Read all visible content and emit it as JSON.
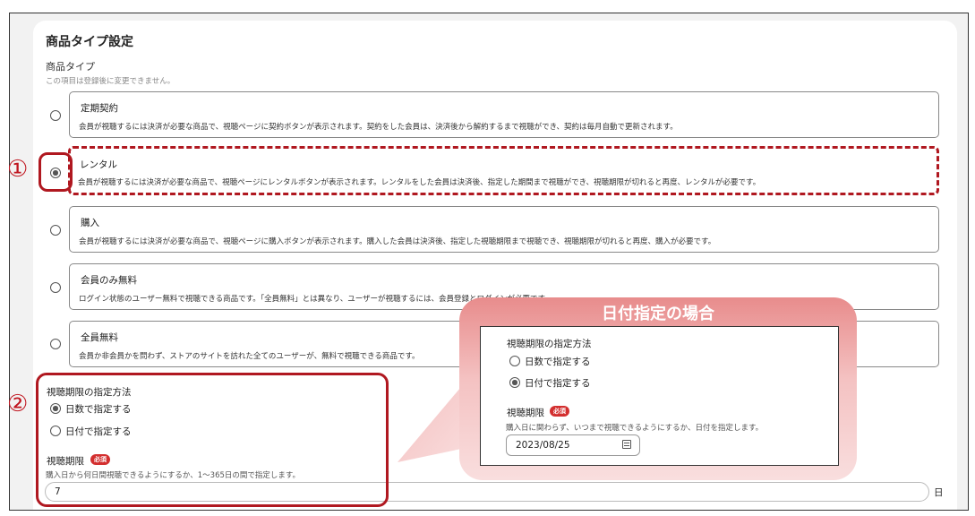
{
  "section": {
    "title": "商品タイプ設定",
    "field_label": "商品タイプ",
    "field_note": "この項目は登録後に変更できません。"
  },
  "options": [
    {
      "title": "定期契約",
      "desc": "会員が視聴するには決済が必要な商品で、視聴ページに契約ボタンが表示されます。契約をした会員は、決済後から解約するまで視聴ができ、契約は毎月自動で更新されます。",
      "selected": false
    },
    {
      "title": "レンタル",
      "desc": "会員が視聴するには決済が必要な商品で、視聴ページにレンタルボタンが表示されます。レンタルをした会員は決済後、指定した期間まで視聴ができ、視聴期限が切れると再度、レンタルが必要です。",
      "selected": true
    },
    {
      "title": "購入",
      "desc": "会員が視聴するには決済が必要な商品で、視聴ページに購入ボタンが表示されます。購入した会員は決済後、指定した視聴期限まで視聴でき、視聴期限が切れると再度、購入が必要です。",
      "selected": false
    },
    {
      "title": "会員のみ無料",
      "desc": "ログイン状態のユーザー無料で視聴できる商品です。「全員無料」とは異なり、ユーザーが視聴するには、会員登録とログインが必要です。",
      "selected": false
    },
    {
      "title": "全員無料",
      "desc": "会員か非会員かを問わず、ストアのサイトを訪れた全てのユーザーが、無料で視聴できる商品です。",
      "selected": false
    }
  ],
  "markers": {
    "one": "①",
    "two": "②"
  },
  "period": {
    "method_label": "視聴期限の指定方法",
    "by_days": "日数で指定する",
    "by_date": "日付で指定する",
    "limit_label": "視聴期限",
    "required": "必須",
    "days_note": "購入日から何日間視聴できるようにするか、1〜365日の間で指定します。",
    "days_value": "7",
    "days_unit": "日"
  },
  "callout": {
    "title": "日付指定の場合",
    "method_label": "視聴期限の指定方法",
    "by_days": "日数で指定する",
    "by_date": "日付で指定する",
    "limit_label": "視聴期限",
    "required": "必須",
    "date_note": "購入日に関わらず、いつまで視聴できるようにするか、日付を指定します。",
    "date_value": "2023/08/25"
  },
  "colors": {
    "highlight": "#b01820",
    "badge": "#d32f2f"
  }
}
